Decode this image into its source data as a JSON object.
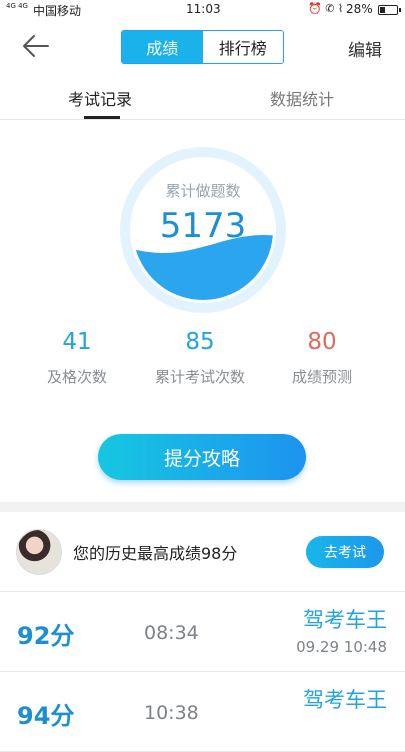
{
  "status_bar": {
    "signal": "4G 4G",
    "carrier": "中国移动",
    "time": "11:03",
    "battery_percent": "28%"
  },
  "header": {
    "segments": [
      "成绩",
      "排行榜"
    ],
    "active_segment": 0,
    "edit_label": "编辑"
  },
  "tabs": [
    "考试记录",
    "数据统计"
  ],
  "gauge": {
    "label": "累计做题数",
    "value": "5173",
    "fill_fraction": 0.4,
    "colors": {
      "ring": "#e3f3fd",
      "wave": "#2aa5ee"
    }
  },
  "stats": [
    {
      "value": "41",
      "label": "及格次数"
    },
    {
      "value": "85",
      "label": "累计考试次数"
    },
    {
      "value": "80",
      "label": "成绩预测"
    }
  ],
  "tips_button": "提分攻略",
  "best": {
    "text": "您的历史最高成绩98分",
    "button": "去考试"
  },
  "records": [
    {
      "score": "92分",
      "duration": "08:34",
      "rank": "驾考车王",
      "date": "09.29  10:48"
    },
    {
      "score": "94分",
      "duration": "10:38",
      "rank": "驾考车王",
      "date": ""
    }
  ]
}
